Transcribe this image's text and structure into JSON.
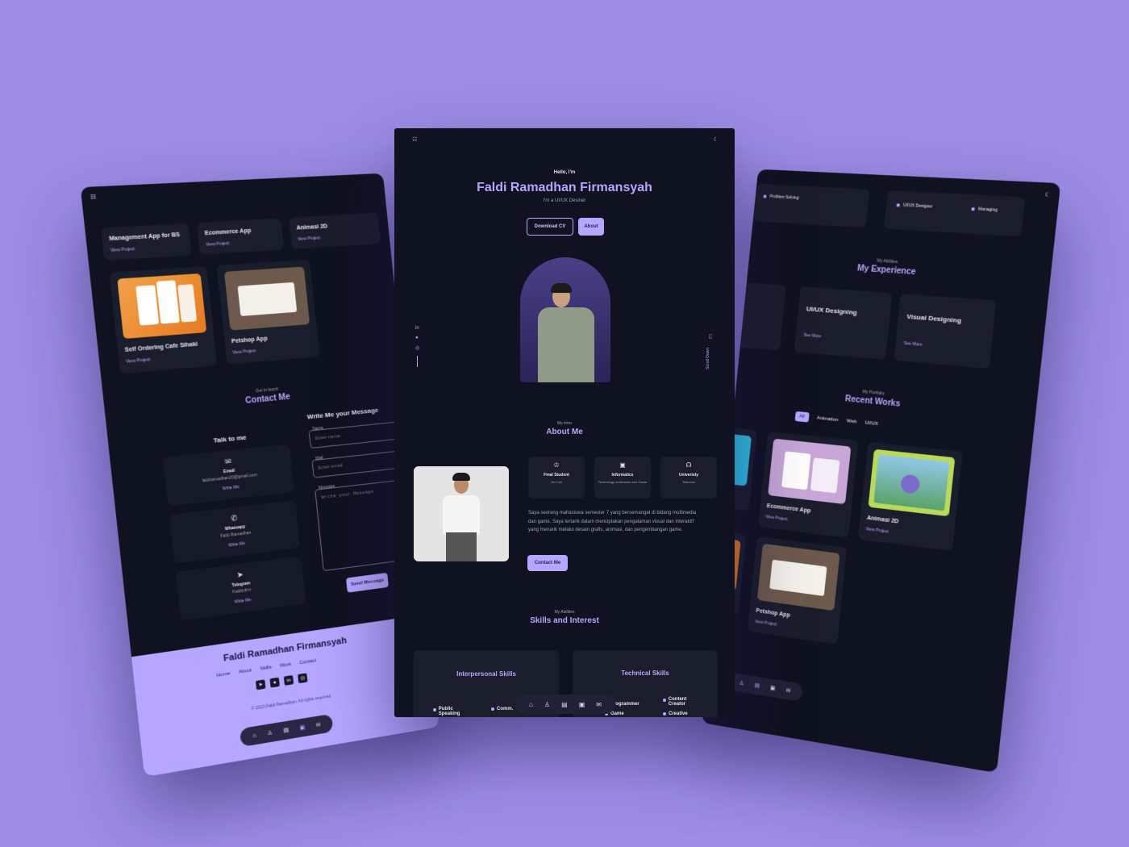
{
  "center": {
    "hello": "Hello, I'm",
    "name": "Faldi Ramadhan Firmansyah",
    "role": "I'm a UI/UX Desiner",
    "download_cv": "Download CV",
    "about_btn": "About",
    "scroll_down": "Scroll Down",
    "about_sub": "My Intro",
    "about_title": "About Me",
    "info_cards": [
      {
        "title": "Final Student",
        "desc": "4th Coll"
      },
      {
        "title": "Informatics",
        "desc": "Technology multimedia and Game"
      },
      {
        "title": "Univeristy",
        "desc": "Telkomsi"
      }
    ],
    "about_text": "Saya seorang mahasiswa semester 7 yang bersemangat di bidang multimedia dan game. Saya tertarik dalam menciptakan pengalaman visual dan interaktif yang menarik melalui desain grafis, animasi, dan pengembangan game.",
    "contact_me": "Contact Me",
    "skills_sub": "My Abilities",
    "skills_title": "Skills and Interest",
    "interpersonal_title": "Interpersonal Skills",
    "technical_title": "Technical Skills",
    "interpersonal_items": [
      "Public Speaking",
      "Comm."
    ],
    "technical_items": [
      "Programmer",
      "Game",
      "Content Creator",
      "Creative"
    ]
  },
  "left": {
    "projects_top": [
      {
        "title": "Management App for BS",
        "link": "View Project"
      },
      {
        "title": "Ecommerce App",
        "link": "View Project"
      },
      {
        "title": "Animasi 2D",
        "link": "View Project"
      }
    ],
    "projects_mid": [
      {
        "title": "Self Ordering Cafe Sihaki",
        "link": "View Project"
      },
      {
        "title": "Petshop App",
        "link": "View Project"
      }
    ],
    "contact_sub": "Get in touch",
    "contact_title": "Contact Me",
    "talk_title": "Talk to me",
    "write_title": "Write Me your Message",
    "contacts": [
      {
        "label": "Email",
        "value": "faldiramadhan20@gmail.com",
        "link": "Write Me"
      },
      {
        "label": "Whatsapp",
        "value": "Faldi Ramadhan",
        "link": "Write Me"
      },
      {
        "label": "Telegram",
        "value": "Faldimfrm",
        "link": "Write Me"
      }
    ],
    "name_label": "Name",
    "name_placeholder": "Enter name",
    "email_label": "Mail",
    "email_placeholder": "Enter email",
    "message_label": "Message",
    "message_placeholder": "Write your Message",
    "send_btn": "Send Message",
    "footer_name": "Faldi Ramadhan Firmansyah",
    "footer_links": [
      "Home",
      "About",
      "Skills",
      "Work",
      "Contact"
    ],
    "copyright": "© 2023 Faldi Ramadhan. All rights reserved"
  },
  "right": {
    "top_items": [
      "Problem Solving",
      "UI/UX Designer",
      "Managing"
    ],
    "exp_sub": "My Abilities",
    "exp_title": "My Experience",
    "exp_cards": [
      {
        "title": "UI/UX Designing",
        "link": "See More"
      },
      {
        "title": "Visual Designing",
        "link": "See More"
      }
    ],
    "works_sub": "My Portfolio",
    "works_title": "Recent Works",
    "filters": [
      "All",
      "Animation",
      "Web",
      "UI/UX"
    ],
    "works": [
      {
        "title": "Ecommerce App",
        "link": "View Project"
      },
      {
        "title": "Animasi 2D",
        "link": "View Project"
      },
      {
        "title": "Petshop App",
        "link": "View Project"
      }
    ]
  },
  "colors": {
    "bg": "#9f8ee8",
    "screen": "#0f1220",
    "card": "#1a1d2b",
    "accent": "#b6a6ff"
  }
}
